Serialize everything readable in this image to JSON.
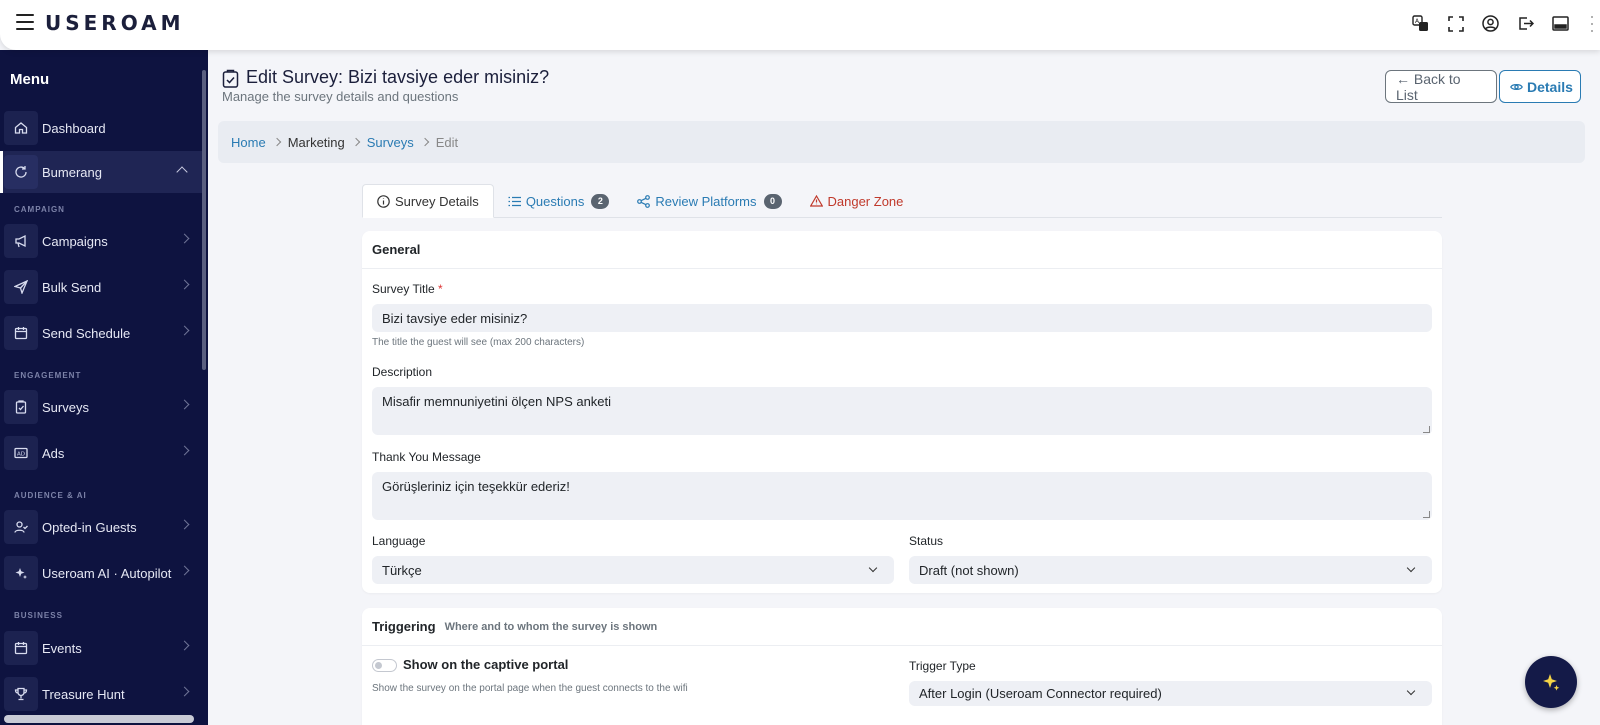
{
  "brand": {
    "logo_text": "USEROAM"
  },
  "sidebar": {
    "title": "Menu",
    "items": [
      {
        "label": "Dashboard",
        "icon": "home-icon"
      },
      {
        "label": "Bumerang",
        "icon": "refresh-icon"
      },
      {
        "label": "Campaigns",
        "icon": "megaphone-icon"
      },
      {
        "label": "Bulk Send",
        "icon": "send-icon"
      },
      {
        "label": "Send Schedule",
        "icon": "calendar-icon"
      },
      {
        "label": "Surveys",
        "icon": "clipboard-icon"
      },
      {
        "label": "Ads",
        "icon": "ad-icon"
      },
      {
        "label": "Opted-in Guests",
        "icon": "user-check-icon"
      },
      {
        "label": "Useroam AI · Autopilot",
        "icon": "sparkle-icon"
      },
      {
        "label": "Events",
        "icon": "calendar-icon"
      },
      {
        "label": "Treasure Hunt",
        "icon": "trophy-icon"
      }
    ],
    "sections": [
      "CAMPAIGN",
      "ENGAGEMENT",
      "AUDIENCE & AI",
      "BUSINESS"
    ]
  },
  "header": {
    "title": "Edit Survey: Bizi tavsiye eder misiniz?",
    "subtitle": "Manage the survey details and questions",
    "back_label": "← Back to List",
    "details_label": "Details"
  },
  "breadcrumb": [
    "Home",
    "Marketing",
    "Surveys",
    "Edit"
  ],
  "tabs": [
    {
      "label": "Survey Details"
    },
    {
      "label": "Questions",
      "badge": "2"
    },
    {
      "label": "Review Platforms",
      "badge": "0"
    },
    {
      "label": "Danger Zone"
    }
  ],
  "general": {
    "heading": "General",
    "title_label": "Survey Title",
    "title_required": "*",
    "title_value": "Bizi tavsiye eder misiniz?",
    "title_help": "The title the guest will see (max 200 characters)",
    "description_label": "Description",
    "description_value": "Misafir memnuniyetini ölçen NPS anketi",
    "thanks_label": "Thank You Message",
    "thanks_value": "Görüşleriniz için teşekkür ederiz!",
    "language_label": "Language",
    "language_value": "Türkçe",
    "status_label": "Status",
    "status_value": "Draft (not shown)"
  },
  "triggering": {
    "heading": "Triggering",
    "hint": "Where and to whom the survey is shown",
    "portal_label": "Show on the captive portal",
    "portal_enabled": false,
    "portal_help": "Show the survey on the portal page when the guest connects to the wifi",
    "trigger_label": "Trigger Type",
    "trigger_value": "After Login (Useroam Connector required)"
  },
  "colors": {
    "sidebar_bg": "#0e1340",
    "link": "#2a7bb3",
    "danger": "#c0392b"
  }
}
